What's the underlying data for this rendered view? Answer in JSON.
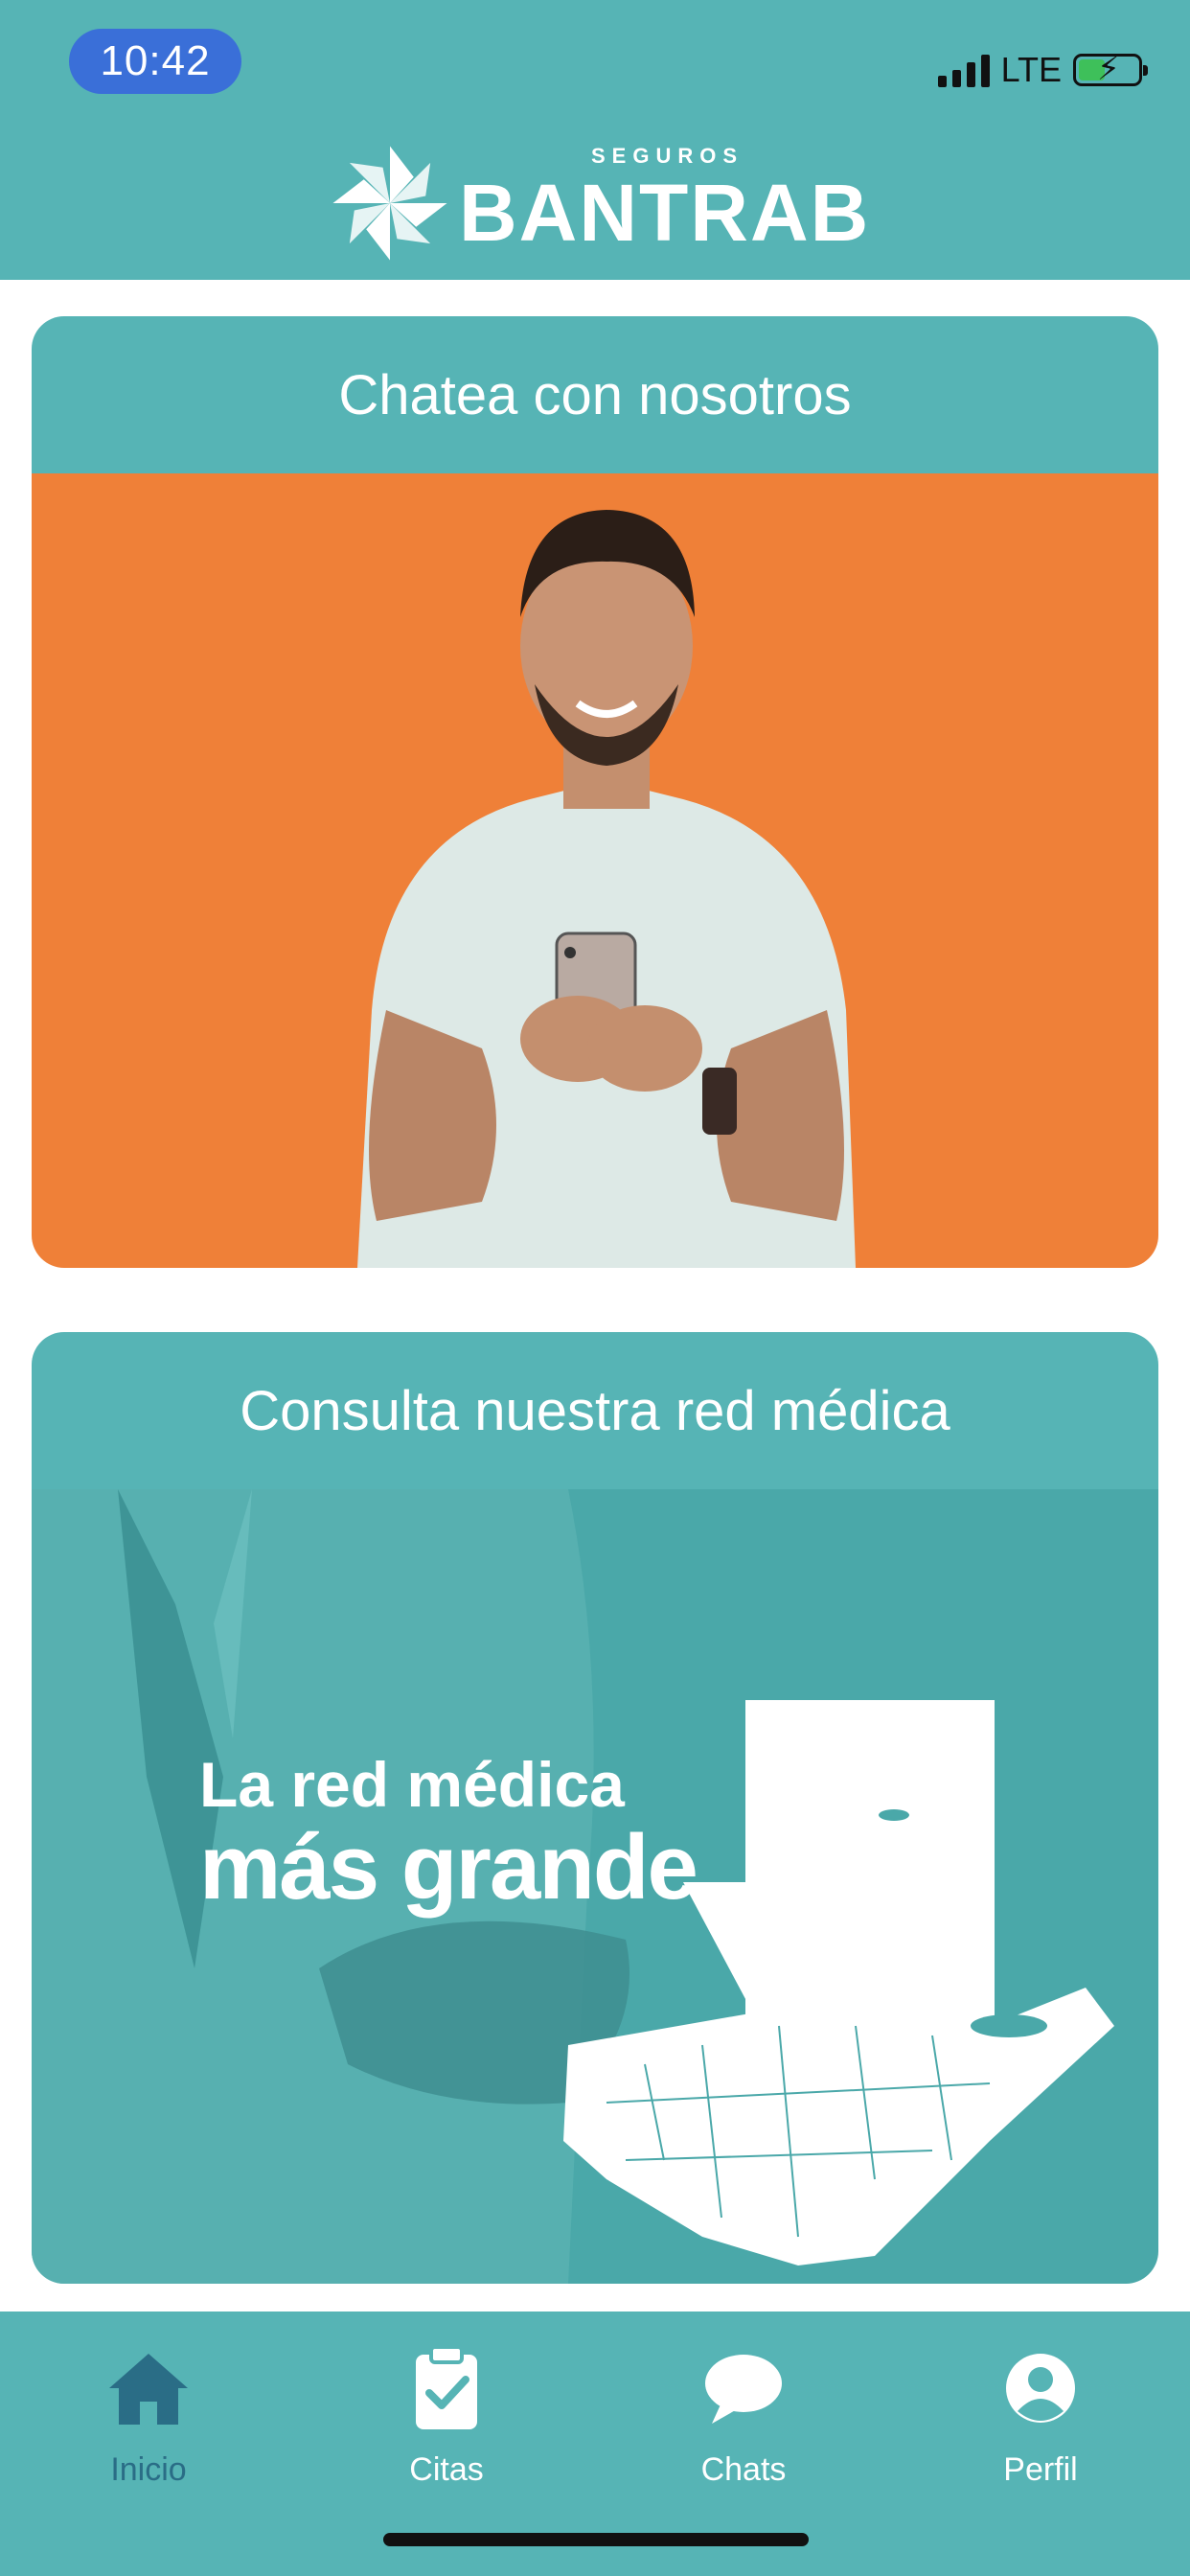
{
  "status_bar": {
    "time": "10:42",
    "network": "LTE",
    "battery_icon": "battery-charging-icon",
    "signal_icon": "signal-icon"
  },
  "header": {
    "brand_sub": "SEGUROS",
    "brand_main": "BANTRAB",
    "logo_icon": "bantrab-pinwheel-icon"
  },
  "cards": [
    {
      "title": "Chatea con nosotros",
      "image": "man-smiling-with-phone"
    },
    {
      "title": "Consulta nuestra red médica",
      "image": "doctor-and-guatemala-map",
      "promo_line1": "La red médica",
      "promo_line2": "más grande"
    }
  ],
  "nav": {
    "items": [
      {
        "label": "Inicio",
        "icon": "home-icon",
        "active": true
      },
      {
        "label": "Citas",
        "icon": "clipboard-check-icon",
        "active": false
      },
      {
        "label": "Chats",
        "icon": "chat-bubble-icon",
        "active": false
      },
      {
        "label": "Perfil",
        "icon": "user-circle-icon",
        "active": false
      }
    ]
  },
  "colors": {
    "teal": "#56b4b5",
    "orange": "#ef8038",
    "active_nav": "#2a6d86",
    "time_pill": "#3a6fd8"
  }
}
